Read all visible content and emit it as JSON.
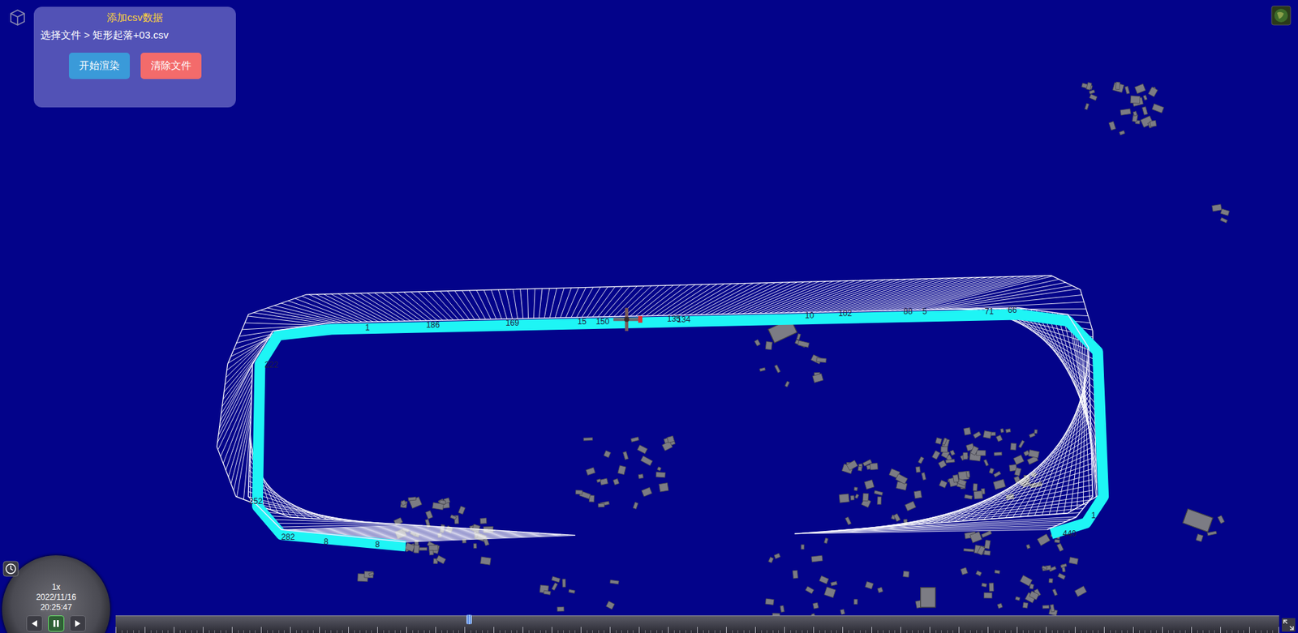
{
  "panel": {
    "title": "添加csv数据",
    "file_path": "选择文件 > 矩形起落+03.csv",
    "buttons": [
      {
        "label": "开始渲染",
        "color": "#3a9ad9"
      },
      {
        "label": "清除文件",
        "color": "#f36b6b"
      }
    ]
  },
  "track": {
    "labels": [
      {
        "text": "1"
      },
      {
        "text": "186"
      },
      {
        "text": "169"
      },
      {
        "text": "15"
      },
      {
        "text": "150"
      },
      {
        "text": "135"
      },
      {
        "text": "134"
      },
      {
        "text": "10"
      },
      {
        "text": "102"
      },
      {
        "text": "88"
      },
      {
        "text": "5"
      },
      {
        "text": "71"
      },
      {
        "text": "66"
      },
      {
        "text": "222"
      },
      {
        "text": "252"
      },
      {
        "text": "282"
      },
      {
        "text": "8"
      },
      {
        "text": "8"
      },
      {
        "text": "440"
      },
      {
        "text": "1"
      }
    ]
  },
  "clock": {
    "speed": "1x",
    "date": "2022/11/16",
    "time": "20:25:47",
    "playing": true
  },
  "timeline": {
    "level": 0.304
  }
}
